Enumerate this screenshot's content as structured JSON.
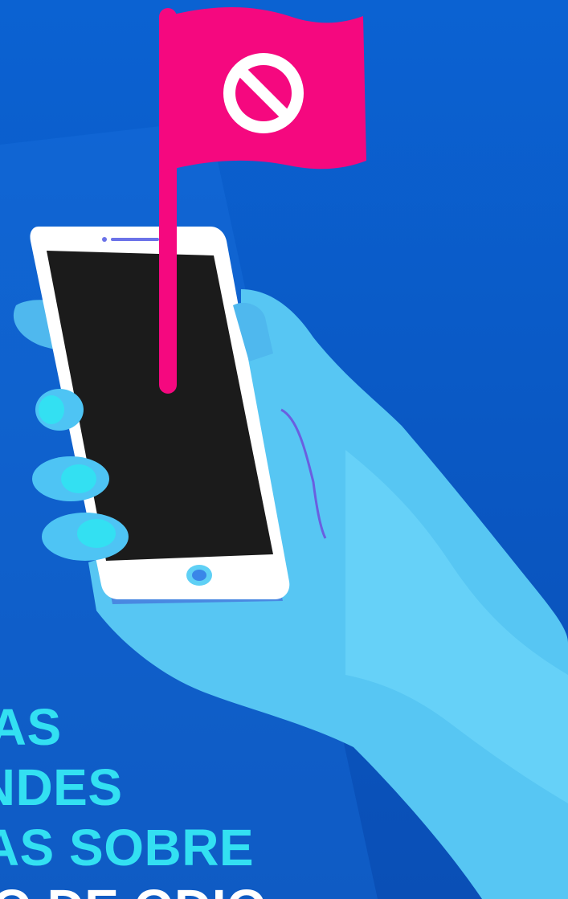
{
  "headline": {
    "line_1": "CAS",
    "line_2": "ANDES",
    "line_3": "MAS SOBRE",
    "line_4": "O DE ODIO"
  },
  "colors": {
    "background": "#0a5cc8",
    "hand": "#5fd0f5",
    "flag": "#f5087f",
    "phone_body": "#ffffff",
    "phone_screen": "#1b1b1b",
    "headline_text": "#33e0f2"
  },
  "icons": {
    "flag_symbol": "prohibited-icon"
  }
}
